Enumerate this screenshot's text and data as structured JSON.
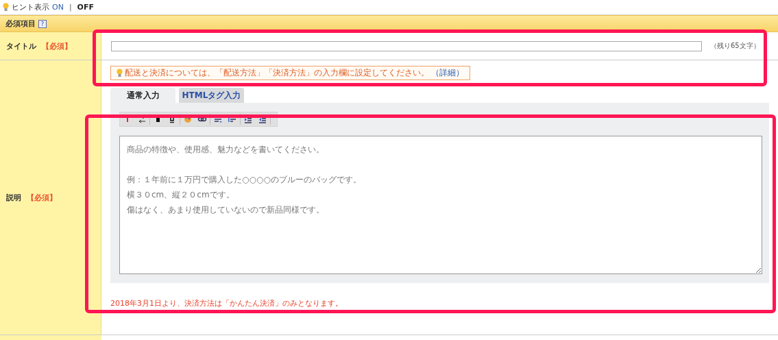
{
  "hint_toggle": {
    "label": "ヒント表示",
    "separator": "|",
    "options": [
      {
        "label": "ON",
        "selected": false
      },
      {
        "label": "OFF",
        "selected": true
      }
    ]
  },
  "section": {
    "title": "必須項目",
    "help": "?"
  },
  "title_row": {
    "label": "タイトル",
    "required": "【必須】",
    "counter": "（残り65文字）"
  },
  "description_row": {
    "label": "説明",
    "required": "【必須】",
    "notice": {
      "text": "配送と決済については、「配送方法」「決済方法」の入力欄に設定してください。",
      "link": "（詳細）"
    },
    "tabs": [
      {
        "label": "通常入力",
        "selected": true
      },
      {
        "label": "HTMLタグ入力",
        "selected": false
      }
    ],
    "placeholder": [
      "商品の特徴や、使用感、魅力などを書いてください。",
      "例：１年前に１万円で購入した○○○○のブルーのバッグです。",
      "横３０cm、縦２０cmです。",
      "傷はなく、あまり使用していないので新品同様です。"
    ],
    "warning": "2018年3月1日より、決済方法は「かんたん決済」のみとなります。"
  }
}
